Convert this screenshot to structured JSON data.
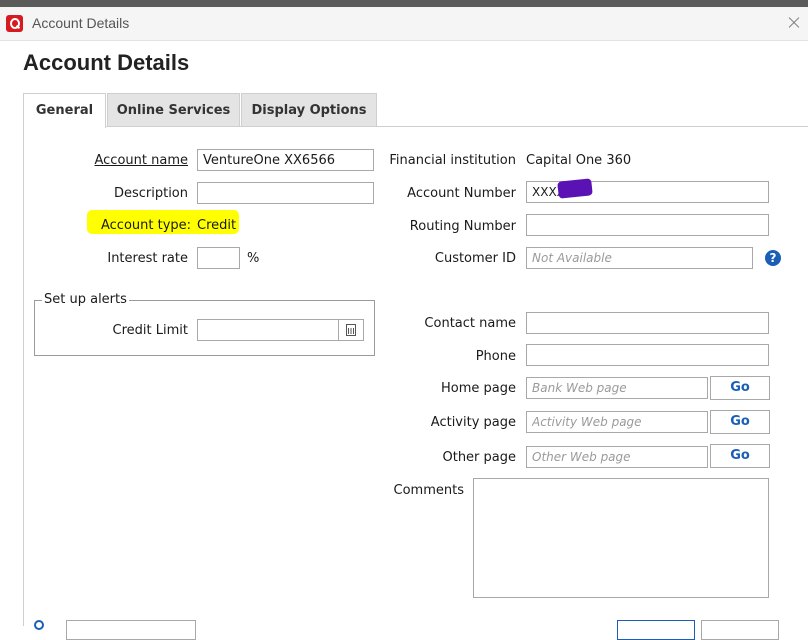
{
  "window": {
    "title": "Account Details"
  },
  "heading": "Account Details",
  "tabs": [
    {
      "label": "General",
      "active": true
    },
    {
      "label": "Online Services",
      "active": false
    },
    {
      "label": "Display Options",
      "active": false
    }
  ],
  "left": {
    "account_name": {
      "label": "Account name",
      "value": "VentureOne XX6566"
    },
    "description": {
      "label": "Description",
      "value": ""
    },
    "account_type": {
      "label": "Account type:",
      "value": "Credit"
    },
    "interest_rate": {
      "label": "Interest rate",
      "value": "",
      "unit": "%"
    },
    "alerts": {
      "legend": "Set up alerts",
      "credit_limit_label": "Credit Limit",
      "credit_limit_value": ""
    }
  },
  "right": {
    "financial_institution": {
      "label": "Financial institution",
      "value": "Capital One 360"
    },
    "account_number": {
      "label": "Account Number",
      "value": "XXXX"
    },
    "routing_number": {
      "label": "Routing Number",
      "value": ""
    },
    "customer_id": {
      "label": "Customer ID",
      "placeholder": "Not Available"
    },
    "contact_name": {
      "label": "Contact name",
      "value": ""
    },
    "phone": {
      "label": "Phone",
      "value": ""
    },
    "home_page": {
      "label": "Home page",
      "placeholder": "Bank Web page",
      "go": "Go"
    },
    "activity_page": {
      "label": "Activity page",
      "placeholder": "Activity Web page",
      "go": "Go"
    },
    "other_page": {
      "label": "Other page",
      "placeholder": "Other Web page",
      "go": "Go"
    },
    "comments": {
      "label": "Comments",
      "value": ""
    }
  },
  "colors": {
    "accent": "#1b5eb8",
    "highlight": "#ffff00",
    "redaction": "#5a12b4",
    "app_icon": "#d71920"
  },
  "icons": [
    "app-logo-icon",
    "close-icon",
    "calculator-icon",
    "help-icon"
  ]
}
